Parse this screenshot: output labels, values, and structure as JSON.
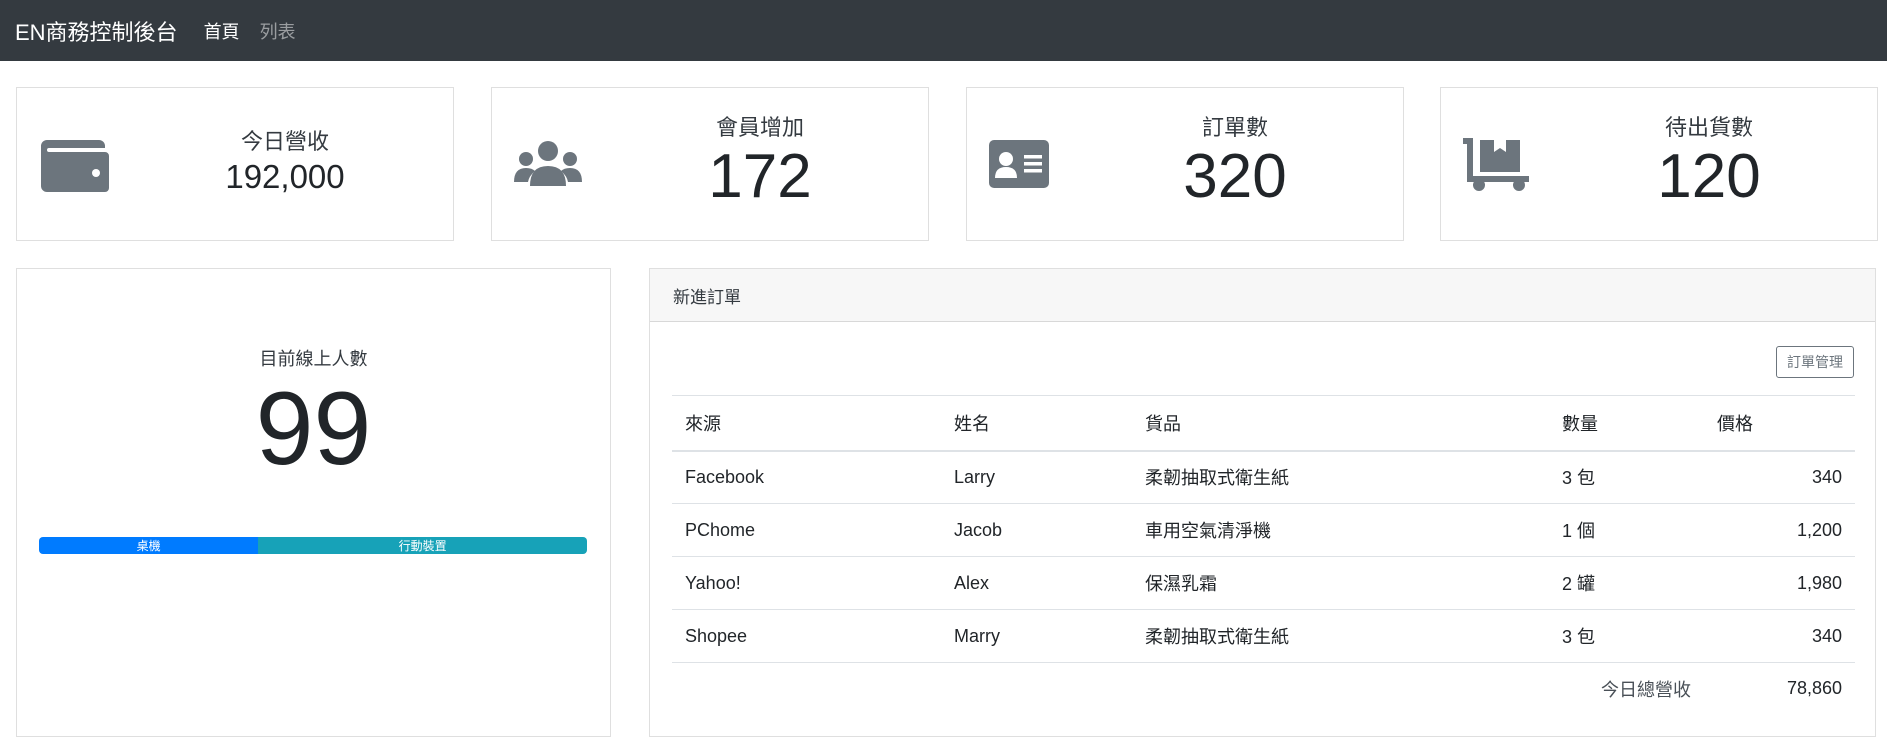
{
  "navbar": {
    "brand": "EN商務控制後台",
    "links": [
      {
        "label": "首頁",
        "active": true
      },
      {
        "label": "列表",
        "active": false
      }
    ]
  },
  "stats": [
    {
      "label": "今日營收",
      "value": "192,000",
      "icon": "wallet-icon"
    },
    {
      "label": "會員增加",
      "value": "172",
      "icon": "users-icon"
    },
    {
      "label": "訂單數",
      "value": "320",
      "icon": "id-card-icon"
    },
    {
      "label": "待出貨數",
      "value": "120",
      "icon": "dolly-icon"
    }
  ],
  "online": {
    "label": "目前線上人數",
    "value": "99",
    "segments": [
      {
        "label": "桌機",
        "percent": 40,
        "color": "#007bff"
      },
      {
        "label": "行動裝置",
        "percent": 60,
        "color": "#17a2b8"
      }
    ]
  },
  "orders": {
    "title": "新進訂單",
    "manage_button": "訂單管理",
    "columns": [
      "來源",
      "姓名",
      "貨品",
      "數量",
      "價格"
    ],
    "rows": [
      {
        "source": "Facebook",
        "name": "Larry",
        "item": "柔韌抽取式衛生紙",
        "qty": "3 包",
        "price": "340"
      },
      {
        "source": "PChome",
        "name": "Jacob",
        "item": "車用空氣清淨機",
        "qty": "1 個",
        "price": "1,200"
      },
      {
        "source": "Yahoo!",
        "name": "Alex",
        "item": "保濕乳霜",
        "qty": "2 罐",
        "price": "1,980"
      },
      {
        "source": "Shopee",
        "name": "Marry",
        "item": "柔韌抽取式衛生紙",
        "qty": "3 包",
        "price": "340"
      }
    ],
    "total_label": "今日總營收",
    "total_value": "78,860"
  },
  "colors": {
    "navbar_bg": "#343a40",
    "icon_gray": "#6c757d",
    "desktop": "#007bff",
    "mobile": "#17a2b8"
  }
}
